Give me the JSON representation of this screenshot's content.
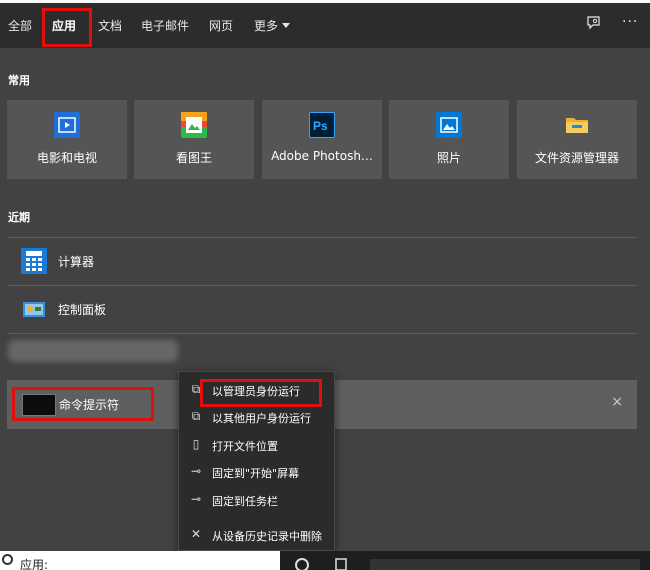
{
  "tabs": [
    {
      "label": "全部"
    },
    {
      "label": "应用"
    },
    {
      "label": "文档"
    },
    {
      "label": "电子邮件"
    },
    {
      "label": "网页"
    },
    {
      "label": "更多"
    }
  ],
  "active_tab": "应用",
  "icons": {
    "feedback": "feedback-icon",
    "more": "more-options-icon",
    "more_glyph": "···"
  },
  "sections": {
    "frequent_title": "常用",
    "recent_title": "近期"
  },
  "frequent_apps": [
    {
      "label": "电影和电视",
      "icon": "movies-tv-icon",
      "color": "#1e6fd9"
    },
    {
      "label": "看图王",
      "icon": "kantuwang-icon",
      "color": "#2fb84a"
    },
    {
      "label": "Adobe Photosh…",
      "icon": "photoshop-icon",
      "color": "#001e36"
    },
    {
      "label": "照片",
      "icon": "photos-icon",
      "color": "#0078d7"
    },
    {
      "label": "文件资源管理器",
      "icon": "file-explorer-icon",
      "color": "#f0c040"
    }
  ],
  "recent_apps": [
    {
      "label": "计算器",
      "icon": "calculator-icon",
      "color": "#1a7ad8"
    },
    {
      "label": "控制面板",
      "icon": "control-panel-icon",
      "color": "#3a8fd8"
    }
  ],
  "selected_result": {
    "label": "命令提示符",
    "icon": "command-prompt-icon",
    "close_glyph": "×"
  },
  "context_menu": [
    {
      "label": "以管理员身份运行",
      "icon": "run-as-admin-icon",
      "glyph": "⧉"
    },
    {
      "label": "以其他用户身份运行",
      "icon": "run-as-other-user-icon",
      "glyph": "⧉"
    },
    {
      "label": "打开文件位置",
      "icon": "open-file-location-icon",
      "glyph": "▯"
    },
    {
      "label": "固定到\"开始\"屏幕",
      "icon": "pin-start-icon",
      "glyph": "⊸"
    },
    {
      "label": "固定到任务栏",
      "icon": "pin-taskbar-icon",
      "glyph": "⊸"
    },
    {
      "label": "从设备历史记录中删除",
      "icon": "remove-from-history-icon",
      "glyph": "✕"
    }
  ],
  "search_box": {
    "value": "应用:"
  },
  "colors": {
    "highlight_box": "#e01010",
    "panel_bg": "#424242",
    "tile_bg": "#555555"
  }
}
